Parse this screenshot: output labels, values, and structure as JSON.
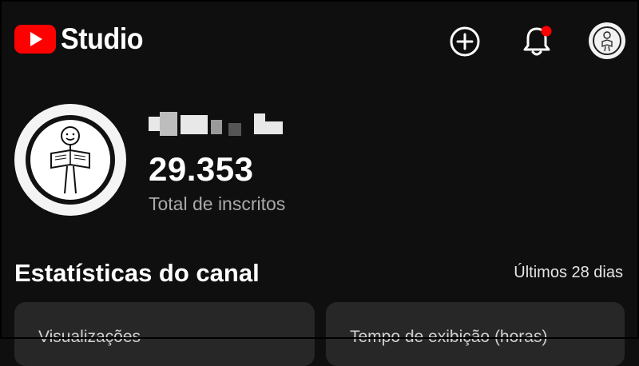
{
  "header": {
    "logo_text": "Studio",
    "icons": [
      "youtube-logo-icon",
      "create-plus-icon",
      "notifications-bell-icon",
      "account-avatar-icon"
    ],
    "notification_dot_color": "#ff0000"
  },
  "channel": {
    "subscriber_count": "29.353",
    "subscriber_label": "Total de inscritos"
  },
  "stats": {
    "title": "Estatísticas do canal",
    "period": "Últimos 28 dias",
    "cards": [
      {
        "label": "Visualizações"
      },
      {
        "label": "Tempo de exibição (horas)"
      }
    ]
  },
  "colors": {
    "background": "#0f0f0f",
    "card": "#272727",
    "brand_red": "#ff0000",
    "secondary_text": "#aaaaaa"
  }
}
